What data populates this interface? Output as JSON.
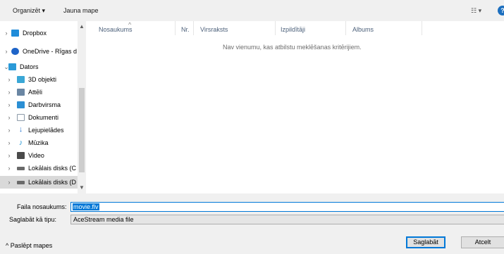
{
  "toolbar": {
    "organize": "Organizēt ▾",
    "new_folder": "Jauna mape",
    "view_icon": "view-options-icon",
    "help_icon": "help-icon"
  },
  "sidebar": {
    "items": [
      {
        "label": "Dropbox",
        "icon": "dropbox-icon",
        "color": "#1f8cd9"
      },
      {
        "label": "OneDrive - Rīgas d",
        "icon": "onedrive-icon",
        "color": "#1e64c8"
      },
      {
        "label": "Dators",
        "icon": "computer-icon",
        "color": "#2b9ad8"
      },
      {
        "label": "3D objekti",
        "icon": "3d-objects-icon",
        "color": "#3aa7d6"
      },
      {
        "label": "Attēli",
        "icon": "pictures-icon",
        "color": "#6a86a3"
      },
      {
        "label": "Darbvirsma",
        "icon": "desktop-icon",
        "color": "#2b8fd4"
      },
      {
        "label": "Dokumenti",
        "icon": "documents-icon",
        "color": "#8c9aa8"
      },
      {
        "label": "Lejupielādes",
        "icon": "downloads-icon",
        "color": "#2b78d0"
      },
      {
        "label": "Mūzika",
        "icon": "music-icon",
        "color": "#2b9ad8"
      },
      {
        "label": "Video",
        "icon": "video-icon",
        "color": "#4a4a4a"
      },
      {
        "label": "Lokālais disks (C",
        "icon": "drive-c-icon",
        "color": "#6a6a6a"
      },
      {
        "label": "Lokālais disks (D",
        "icon": "drive-d-icon",
        "color": "#6a6a6a"
      }
    ]
  },
  "columns": [
    "Nosaukums",
    "Nr.",
    "Virsraksts",
    "Izpildītāji",
    "Albums"
  ],
  "empty_message": "Nav vienumu, kas atbilstu meklēšanas kritērijiem.",
  "form": {
    "filename_label": "Faila nosaukums:",
    "filename_value": "movie.flv",
    "type_label": "Saglabāt kā tipu:",
    "type_value": "AceStream media file"
  },
  "footer": {
    "hide_folders": "Paslēpt mapes",
    "save": "Saglabāt",
    "cancel": "Atcelt"
  }
}
